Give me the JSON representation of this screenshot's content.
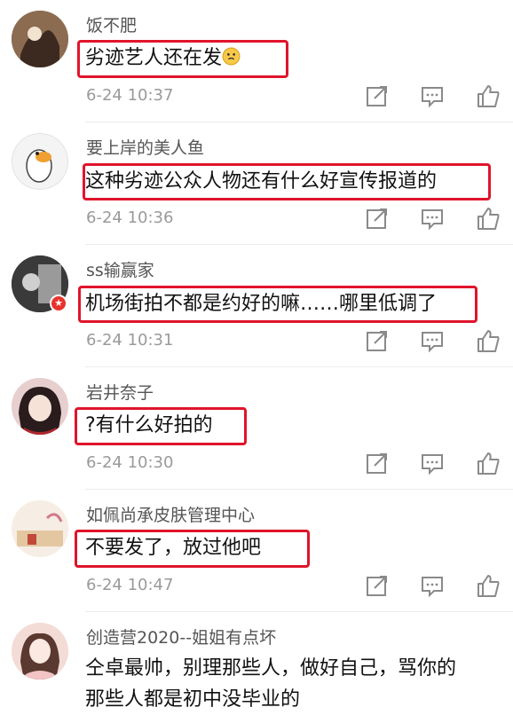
{
  "comments": [
    {
      "username": "饭不肥",
      "text": "劣迹艺人还在发",
      "time": "6-24 10:37",
      "emoji": "thinking-face-emoji"
    },
    {
      "username": "要上岸的美人鱼",
      "text": "这种劣迹公众人物还有什么好宣传报道的",
      "time": "6-24 10:36"
    },
    {
      "username": "ss输赢家",
      "text": "机场街拍不都是约好的嘛……哪里低调了",
      "time": "6-24 10:31"
    },
    {
      "username": "岩井奈子",
      "text": "?有什么好拍的",
      "time": "6-24 10:30"
    },
    {
      "username": "如佩尚承皮肤管理中心",
      "text": "不要发了，放过他吧",
      "time": "6-24 10:47"
    },
    {
      "username": "创造营2020--姐姐有点坏",
      "text_line1": "仝卓最帅，别理那些人，做好自己，骂你的",
      "text_line2": "那些人都是初中没毕业的"
    }
  ],
  "icons": {
    "repost": "repost-icon",
    "comment": "comment-icon",
    "like": "like-icon"
  },
  "colors": {
    "highlight": "#e0142b",
    "badge": "#e8322c",
    "meta": "#9a9a9a"
  }
}
